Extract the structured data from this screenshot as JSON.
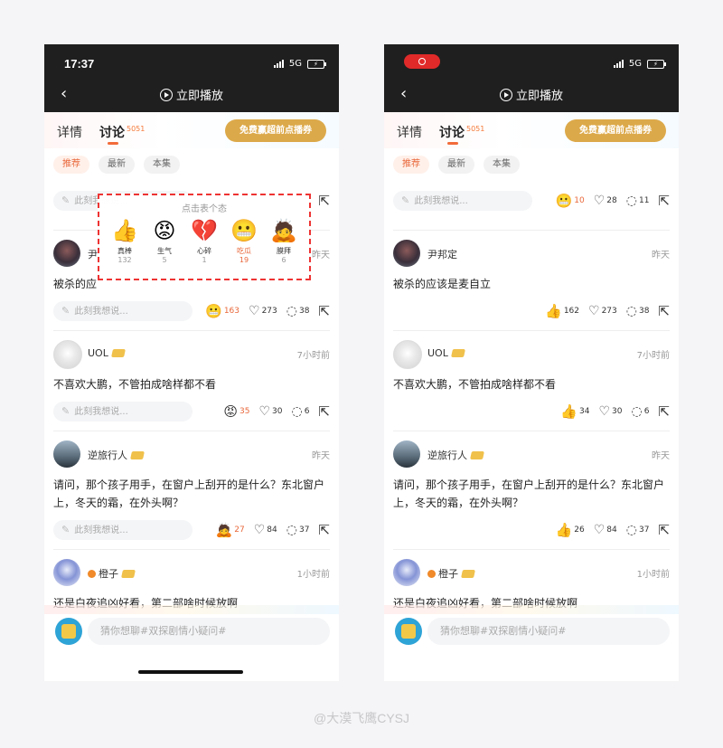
{
  "status": {
    "time": "17:37",
    "network": "5G"
  },
  "header": {
    "title": "立即播放"
  },
  "tabs": {
    "detail": "详情",
    "discuss": "讨论",
    "discuss_count": "5051",
    "promo": "免费赢超前点播券"
  },
  "filters": [
    "推荐",
    "最新",
    "本集"
  ],
  "input_placeholder": "此刻我想说...",
  "top_actions": {
    "reaction_count": "10",
    "likes": "28",
    "comments": "11"
  },
  "popup": {
    "title": "点击表个态",
    "items": [
      {
        "emoji": "👍",
        "label": "真棒",
        "count": "132"
      },
      {
        "emoji": "😡",
        "label": "生气",
        "count": "5"
      },
      {
        "emoji": "💔",
        "label": "心碎",
        "count": "1"
      },
      {
        "emoji": "😬",
        "label": "吃瓜",
        "count": "19"
      },
      {
        "emoji": "🙇",
        "label": "膜拜",
        "count": "6"
      }
    ]
  },
  "posts_left": [
    {
      "name": "尹",
      "time": "昨天",
      "text": "被杀的应",
      "reaction": "😬",
      "reaction_count": "163",
      "likes": "273",
      "comments": "38"
    },
    {
      "name": "UOL",
      "time": "7小时前",
      "text": "不喜欢大鹏，不管拍成啥样都不看",
      "reaction": "😡",
      "reaction_count": "35",
      "likes": "30",
      "comments": "6"
    },
    {
      "name": "逆旅行人",
      "time": "昨天",
      "text": "请问，那个孩子用手，在窗户上刮开的是什么？东北窗户上，冬天的霜，在外头啊？",
      "reaction": "🙇",
      "reaction_count": "27",
      "likes": "84",
      "comments": "37"
    },
    {
      "name": "橙子",
      "time": "1小时前",
      "text": "还是白夜追凶好看，第二部啥时候放啊"
    }
  ],
  "posts_right": [
    {
      "name": "尹邦定",
      "time": "昨天",
      "text": "被杀的应该是麦自立",
      "reaction": "👍",
      "reaction_count": "162",
      "likes": "273",
      "comments": "38"
    },
    {
      "name": "UOL",
      "time": "7小时前",
      "text": "不喜欢大鹏，不管拍成啥样都不看",
      "reaction": "👍",
      "reaction_count": "34",
      "likes": "30",
      "comments": "6"
    },
    {
      "name": "逆旅行人",
      "time": "昨天",
      "text": "请问，那个孩子用手，在窗户上刮开的是什么？东北窗户上，冬天的霜，在外头啊？",
      "reaction": "👍",
      "reaction_count": "26",
      "likes": "84",
      "comments": "37"
    },
    {
      "name": "橙子",
      "time": "1小时前",
      "text": "还是白夜追凶好看，第二部啥时候放啊"
    }
  ],
  "bottom": {
    "placeholder": "猜你想聊#双探剧情小疑问#"
  },
  "watermark": "@大漠飞鹰CYSJ"
}
